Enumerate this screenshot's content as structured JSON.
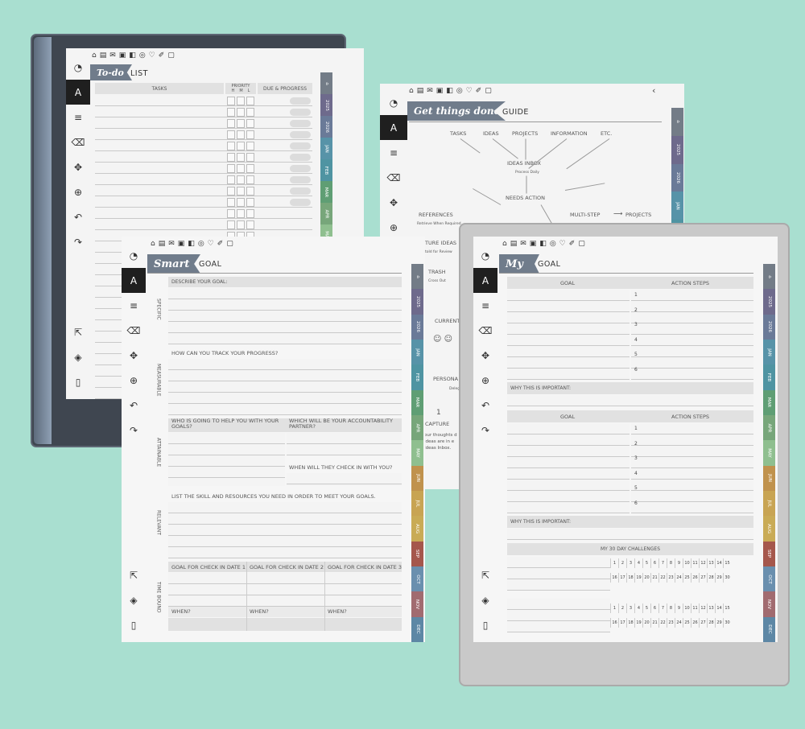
{
  "top_icons": [
    "⌂",
    "▤",
    "✉",
    "▣",
    "◧",
    "◎",
    "♡",
    "✐",
    "▢"
  ],
  "months": [
    "2025",
    "2026",
    "JAN",
    "FEB",
    "MAR",
    "APR",
    "MAY",
    "JUN",
    "JUL",
    "AUG",
    "SEP",
    "OCT",
    "NOV",
    "DEC"
  ],
  "colors": {
    "background": "#a9dfd0",
    "banner": "#707c8b",
    "tab_home": "#737c87",
    "tab_2025": "#6e6a8c",
    "tab_2026": "#6a7a98",
    "tab_jan": "#5793a8",
    "tab_feb": "#4f94a2",
    "tab_mar": "#5f9e74",
    "tab_apr": "#77a67a",
    "tab_may": "#8fbf8f",
    "tab_jun": "#c0924d",
    "tab_jul": "#c8a453",
    "tab_aug": "#c9ab56",
    "tab_sep": "#a5574c",
    "tab_oct": "#6a8fae",
    "tab_nov": "#a16b70",
    "tab_dec": "#5d87a5"
  },
  "todo": {
    "script": "To-do",
    "title": "LIST",
    "tasks_header": "TASKS",
    "priority_header": "PRIORITY",
    "priority_levels": [
      "H",
      "M",
      "L"
    ],
    "due_header": "DUE & PROGRESS"
  },
  "gtd": {
    "script": "Get things done",
    "title": "GUIDE",
    "inputs": [
      "TASKS",
      "IDEAS",
      "PROJECTS",
      "INFORMATION",
      "ETC."
    ],
    "inbox": "IDEAS INBOX",
    "inbox_sub": "Process Daily",
    "needs_action": "NEEDS ACTION",
    "references": "REFERENCES",
    "references_sub": "Retrieve When Required",
    "multi_step": "MULTI-STEP",
    "projects": "PROJECTS",
    "future_ideas": "TURE IDEAS",
    "future_sub": "told for Review",
    "trash": "TRASH",
    "trash_sub": "Cross Out",
    "current": "CURRENT",
    "personal": "PERSONA",
    "delegate": "Deleg",
    "step_num": "1",
    "capture": "CAPTURE",
    "capture_desc": "our thoughts d ideas are in e Ideas Inbox."
  },
  "smart": {
    "script": "Smart",
    "title": "GOAL",
    "specific": "SPECIFIC",
    "specific_q": "DESCRIBE YOUR GOAL:",
    "measurable": "MEASURABLE",
    "measurable_q": "HOW CAN YOU TRACK YOUR PROGRESS?",
    "attainable": "ATTAINABLE",
    "attainable_q1": "WHO IS GOING TO HELP YOU WITH YOUR GOALS?",
    "attainable_q2": "WHICH WILL BE YOUR ACCOUNTABILITY PARTNER?",
    "attainable_q3": "WHEN WILL THEY CHECK IN WITH YOU?",
    "relevant": "RELEVANT",
    "relevant_q": "LIST THE SKILL AND RESOURCES YOU NEED IN ORDER TO MEET YOUR GOALS.",
    "time_bound": "TIME BOUND",
    "checkins": [
      "GOAL FOR CHECK IN DATE 1",
      "GOAL FOR CHECK IN DATE 2",
      "GOAL FOR CHECK IN DATE 3"
    ],
    "when": "WHEN?"
  },
  "my": {
    "script": "My",
    "title": "GOAL",
    "goal_header": "GOAL",
    "steps_header": "ACTION STEPS",
    "steps": [
      "1",
      "2",
      "3",
      "4",
      "5",
      "6"
    ],
    "why": "WHY THIS IS IMPORTANT:",
    "challenge": "MY 30 DAY CHALLENGES",
    "row1": [
      "1",
      "2",
      "3",
      "4",
      "5",
      "6",
      "7",
      "8",
      "9",
      "10",
      "11",
      "12",
      "13",
      "14",
      "15"
    ],
    "row2": [
      "16",
      "17",
      "18",
      "19",
      "20",
      "21",
      "22",
      "23",
      "24",
      "25",
      "26",
      "27",
      "28",
      "29",
      "30"
    ]
  }
}
